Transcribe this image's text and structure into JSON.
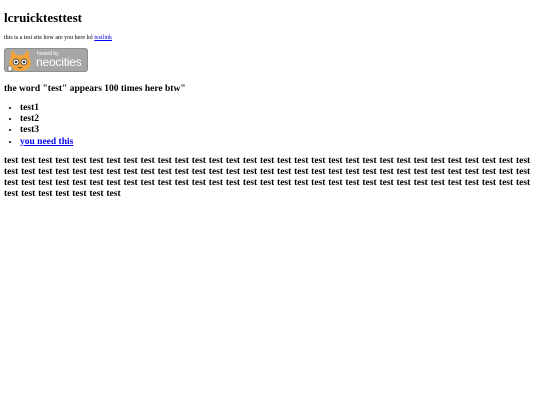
{
  "page": {
    "title": "lcruicktesttest",
    "intro_text": "this is a test site how are you here lol ",
    "intro_link": "testlink",
    "badge": {
      "small_text": "hosted by",
      "brand_text": "neocities",
      "icon": "neocities-cat-logo"
    },
    "note": "the word \"test\" appears 100 times here btw\"",
    "list_items": [
      "test1",
      "test2",
      "test3"
    ],
    "list_link": "you need this",
    "test_word": "test",
    "test_count": 100
  },
  "colors": {
    "link": "#0000ee",
    "badge_bg": "#a6a6a6",
    "text": "#000000"
  }
}
